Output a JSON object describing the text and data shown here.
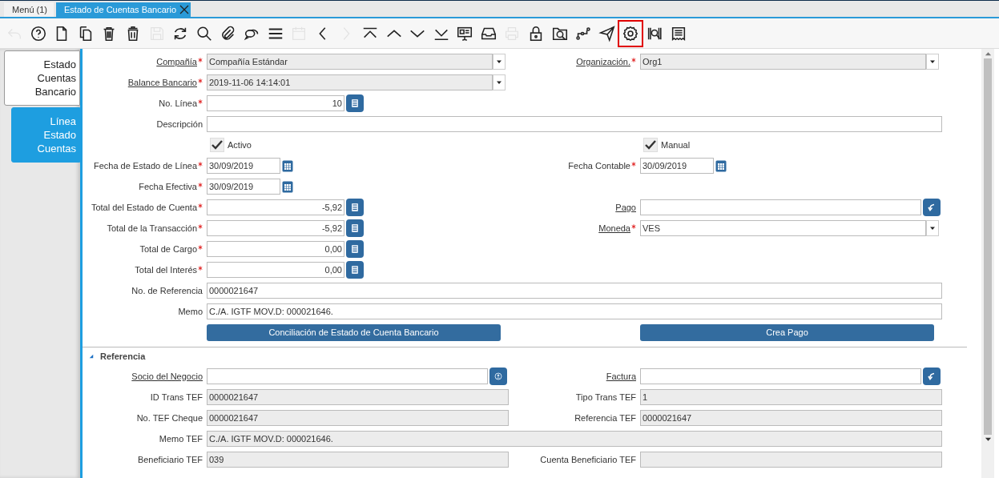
{
  "tabs": [
    {
      "label": "Menú (1)",
      "selected": false,
      "closable": false
    },
    {
      "label": "Estado de Cuentas Bancario",
      "selected": true,
      "closable": true
    }
  ],
  "toolbar": [
    {
      "kind": "undo",
      "disabled": true,
      "highlighted": false
    },
    {
      "kind": "help",
      "disabled": false,
      "highlighted": false
    },
    {
      "kind": "document",
      "disabled": false,
      "highlighted": false
    },
    {
      "kind": "copy",
      "disabled": false,
      "highlighted": false
    },
    {
      "kind": "trash",
      "disabled": false,
      "highlighted": false
    },
    {
      "kind": "trash-bin",
      "disabled": false,
      "highlighted": false
    },
    {
      "kind": "save",
      "disabled": true,
      "highlighted": false
    },
    {
      "kind": "refresh",
      "disabled": false,
      "highlighted": false
    },
    {
      "kind": "search",
      "disabled": false,
      "highlighted": false
    },
    {
      "kind": "paperclip",
      "disabled": false,
      "highlighted": false
    },
    {
      "kind": "chat",
      "disabled": false,
      "highlighted": false
    },
    {
      "kind": "list",
      "disabled": false,
      "highlighted": false
    },
    {
      "kind": "calendar",
      "disabled": true,
      "highlighted": false
    },
    {
      "kind": "chevron-left",
      "disabled": false,
      "highlighted": false
    },
    {
      "kind": "chevron-right",
      "disabled": true,
      "highlighted": false
    },
    {
      "kind": "first-record",
      "disabled": false,
      "highlighted": false
    },
    {
      "kind": "chevron-up",
      "disabled": false,
      "highlighted": false
    },
    {
      "kind": "chevron-down",
      "disabled": false,
      "highlighted": false
    },
    {
      "kind": "last-record",
      "disabled": false,
      "highlighted": false
    },
    {
      "kind": "presentation",
      "disabled": false,
      "highlighted": false
    },
    {
      "kind": "inbox",
      "disabled": false,
      "highlighted": false
    },
    {
      "kind": "printer",
      "disabled": true,
      "highlighted": false
    },
    {
      "kind": "padlock",
      "disabled": false,
      "highlighted": false
    },
    {
      "kind": "folder-search",
      "disabled": false,
      "highlighted": false
    },
    {
      "kind": "workflow",
      "disabled": false,
      "highlighted": false
    },
    {
      "kind": "paper-plane",
      "disabled": false,
      "highlighted": false
    },
    {
      "kind": "settings",
      "disabled": false,
      "highlighted": true
    },
    {
      "kind": "barcode",
      "disabled": false,
      "highlighted": false
    },
    {
      "kind": "receipt",
      "disabled": false,
      "highlighted": false
    }
  ],
  "side_tabs": [
    {
      "label": "Estado Cuentas Bancario",
      "selected": false
    },
    {
      "label": "Línea Estado Cuentas",
      "selected": true
    }
  ],
  "main": {
    "rows": [
      {
        "left": {
          "label": "Compañía",
          "kind": "combo",
          "value": "Compañía Estándar",
          "required": true,
          "link": true,
          "readonly": true
        },
        "right": {
          "label": "Organización.",
          "kind": "combo",
          "value": "Org1",
          "required": true,
          "link": true,
          "readonly": true
        }
      },
      {
        "left": {
          "label": "Balance Bancario",
          "kind": "combo",
          "value": "2019-11-06 14:14:01",
          "required": true,
          "link": true,
          "readonly": true
        }
      },
      {
        "left": {
          "label": "No. Línea",
          "kind": "number",
          "value": "10",
          "required": true,
          "link": false,
          "readonly": false
        }
      },
      {
        "left": {
          "label": "Descripción",
          "kind": "text",
          "required": false,
          "link": false,
          "readonly": false,
          "wide": true
        }
      },
      {
        "left": {
          "label": "Activo",
          "kind": "checkbox",
          "checked": true
        },
        "right": {
          "label": "Manual",
          "kind": "checkbox",
          "checked": true
        }
      },
      {
        "left": {
          "label": "Fecha de Estado de Línea",
          "kind": "date",
          "value": "30/09/2019",
          "required": true,
          "link": false,
          "readonly": false
        },
        "right": {
          "label": "Fecha Contable",
          "kind": "date",
          "value": "30/09/2019",
          "required": true,
          "link": false,
          "readonly": false
        }
      },
      {
        "left": {
          "label": "Fecha Efectiva",
          "kind": "date",
          "value": "30/09/2019",
          "required": true,
          "link": false,
          "readonly": false
        }
      },
      {
        "left": {
          "label": "Total del Estado de Cuenta",
          "kind": "number",
          "value": "-5,92",
          "required": true,
          "link": false,
          "readonly": false
        },
        "right": {
          "label": "Pago",
          "kind": "lookup",
          "required": false,
          "link": true,
          "readonly": false
        }
      },
      {
        "left": {
          "label": "Total de la Transacción",
          "kind": "number",
          "value": "-5,92",
          "required": true,
          "link": false,
          "readonly": false
        },
        "right": {
          "label": "Moneda",
          "kind": "combo",
          "value": "VES",
          "required": true,
          "link": true,
          "readonly": false
        }
      },
      {
        "left": {
          "label": "Total de Cargo",
          "kind": "number",
          "value": "0,00",
          "required": true,
          "link": false,
          "readonly": false
        }
      },
      {
        "left": {
          "label": "Total del Interés",
          "kind": "number",
          "value": "0,00",
          "required": true,
          "link": false,
          "readonly": false
        }
      },
      {
        "left": {
          "label": "No. de Referencia",
          "kind": "text",
          "value": "0000021647",
          "required": false,
          "link": false,
          "readonly": false,
          "wide": true
        }
      },
      {
        "left": {
          "label": "Memo",
          "kind": "text",
          "value": "C./A. IGTF MOV.D: 000021646.",
          "required": false,
          "link": false,
          "readonly": false,
          "wide": true
        }
      },
      {
        "left": {
          "label": "Conciliación de Estado de Cuenta Bancario",
          "kind": "button"
        },
        "right": {
          "label": "Crea Pago",
          "kind": "button"
        }
      }
    ]
  },
  "section": {
    "title": "Referencia",
    "expanded": true,
    "rows": [
      {
        "left": {
          "label": "Socio del Negocio",
          "kind": "partner",
          "required": false,
          "link": true,
          "readonly": false
        },
        "right": {
          "label": "Factura",
          "kind": "lookup",
          "required": false,
          "link": true,
          "readonly": false
        }
      },
      {
        "left": {
          "label": "ID Trans TEF",
          "kind": "text",
          "value": "0000021647",
          "required": false,
          "link": false,
          "readonly": true
        },
        "right": {
          "label": "Tipo Trans TEF",
          "kind": "text",
          "value": "1",
          "required": false,
          "link": false,
          "readonly": true
        }
      },
      {
        "left": {
          "label": "No. TEF Cheque",
          "kind": "text",
          "value": "0000021647",
          "required": false,
          "link": false,
          "readonly": true
        },
        "right": {
          "label": "Referencia TEF",
          "kind": "text",
          "value": "0000021647",
          "required": false,
          "link": false,
          "readonly": true
        }
      },
      {
        "left": {
          "label": "Memo TEF",
          "kind": "text",
          "value": "C./A. IGTF MOV.D: 000021646.",
          "required": false,
          "link": false,
          "readonly": true,
          "wide": true
        }
      },
      {
        "left": {
          "label": "Beneficiario TEF",
          "kind": "text",
          "value": "039",
          "required": false,
          "link": false,
          "readonly": true
        },
        "right": {
          "label": "Cuenta Beneficiario TEF",
          "kind": "text",
          "required": false,
          "link": false,
          "readonly": true
        }
      }
    ]
  }
}
